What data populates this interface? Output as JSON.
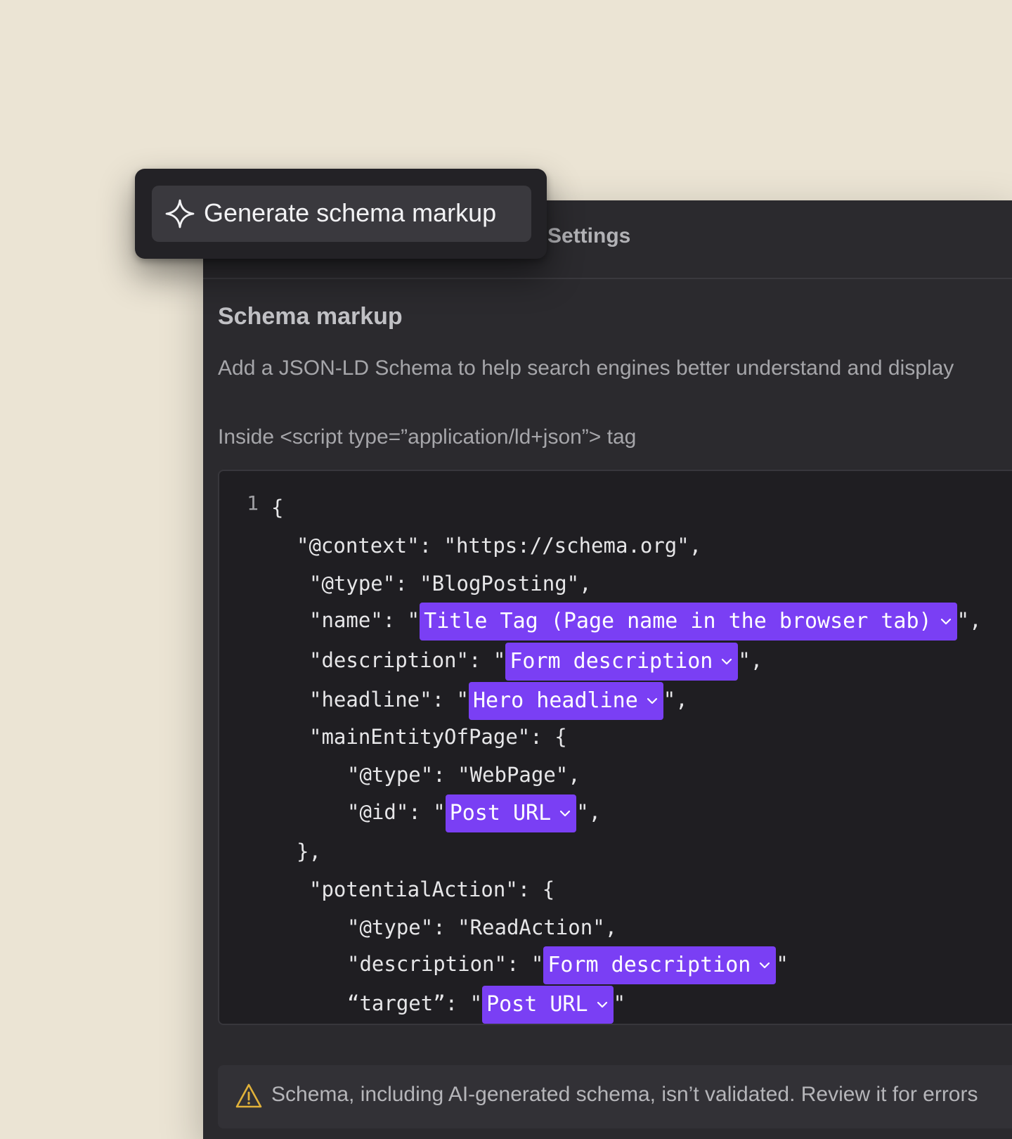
{
  "panel": {
    "header_title": "Settings",
    "section_title": "Schema markup",
    "section_description": "Add a JSON-LD Schema to help search engines better understand and display",
    "code_label": "Inside <script type=”application/ld+json”> tag"
  },
  "popover": {
    "generate_label": "Generate schema markup",
    "icon": "sparkle-icon"
  },
  "code": {
    "line_number": "1",
    "lines": [
      "{",
      "\"@context\": \"https://schema.org\",",
      "\"@type\": \"BlogPosting\",",
      "\"name\": \"",
      "\"description\": \"",
      "\"headline\": \"",
      "\"mainEntityOfPage\": {",
      "\"@type\": \"WebPage\",",
      "\"@id\": \"",
      "},",
      "\"potentialAction\": {",
      "\"@type\": \"ReadAction\",",
      "\"description\": \"",
      "“target”: \""
    ],
    "suffixes": {
      "name": "\",",
      "description": "\",",
      "headline": "\",",
      "id": "\",",
      "action_description": "\"",
      "target": "\""
    },
    "tokens": {
      "name": "Title Tag (Page name in the browser tab)",
      "description": "Form description",
      "headline": "Hero headline",
      "id": "Post URL",
      "action_description": "Form description",
      "target": "Post URL"
    }
  },
  "warning": {
    "text": "Schema, including AI-generated schema, isn’t validated. Review it for errors",
    "icon": "warning-icon",
    "color": "#e0b13a"
  },
  "colors": {
    "background": "#ebe4d4",
    "panel": "#2b2a2e",
    "token_accent": "#7a3ff4"
  }
}
